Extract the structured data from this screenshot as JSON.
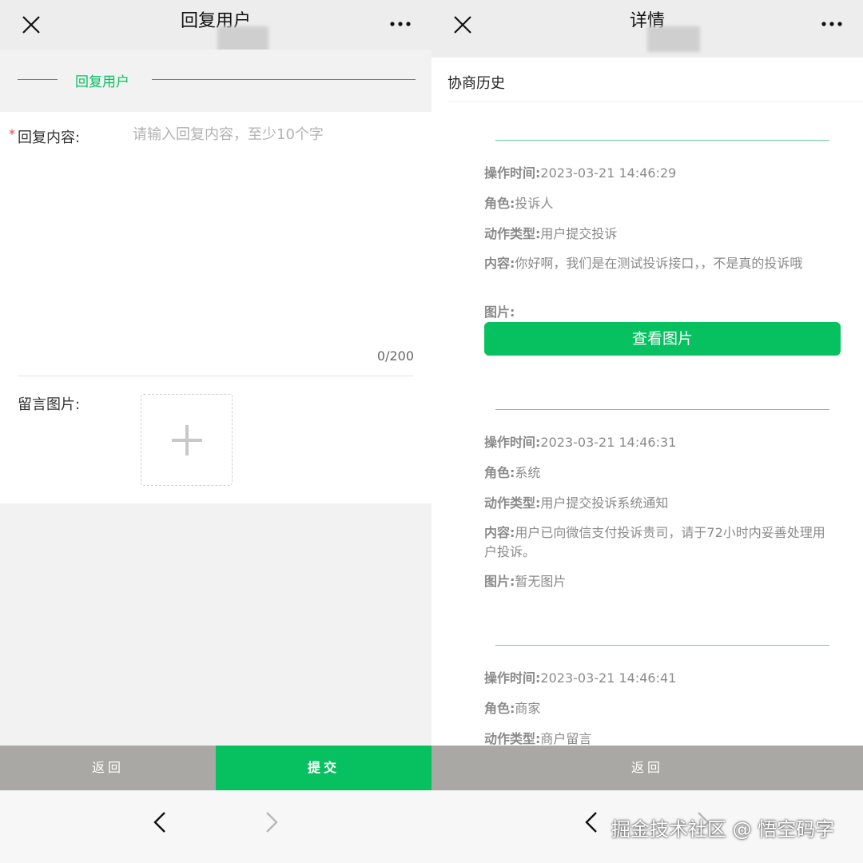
{
  "left": {
    "nav": {
      "title": "回复用户"
    },
    "section_title": "回复用户",
    "form": {
      "required_mark": "*",
      "content_label": "回复内容:",
      "content_placeholder": "请输入回复内容，至少10个字",
      "counter": "0/200",
      "image_label": "留言图片:"
    },
    "buttons": {
      "back": "返回",
      "submit": "提交"
    }
  },
  "right": {
    "nav": {
      "title": "详情"
    },
    "history_title": "协商历史",
    "records": [
      {
        "time_label": "操作时间:",
        "time": "2023-03-21 14:46:29",
        "role_label": "角色:",
        "role": "投诉人",
        "type_label": "动作类型:",
        "type": "用户提交投诉",
        "content_label": "内容:",
        "content": "你好啊，我们是在测试投诉接口，，不是真的投诉哦",
        "image_label": "图片:",
        "image_button": "查看图片"
      },
      {
        "time_label": "操作时间:",
        "time": "2023-03-21 14:46:31",
        "role_label": "角色:",
        "role": "系统",
        "type_label": "动作类型:",
        "type": "用户提交投诉系统通知",
        "content_label": "内容:",
        "content": "用户已向微信支付投诉贵司，请于72小时内妥善处理用户投诉。",
        "image_label": "图片:",
        "image_value": "暂无图片"
      },
      {
        "time_label": "操作时间:",
        "time": "2023-03-21 14:46:41",
        "role_label": "角色:",
        "role": "商家",
        "type_label": "动作类型:",
        "type": "商户留言"
      }
    ],
    "buttons": {
      "back": "返回"
    }
  },
  "watermark": "掘金技术社区 @ 悟空码字",
  "colors": {
    "accent": "#07c160",
    "back_button": "#a9a8a4",
    "required": "#e64340"
  }
}
